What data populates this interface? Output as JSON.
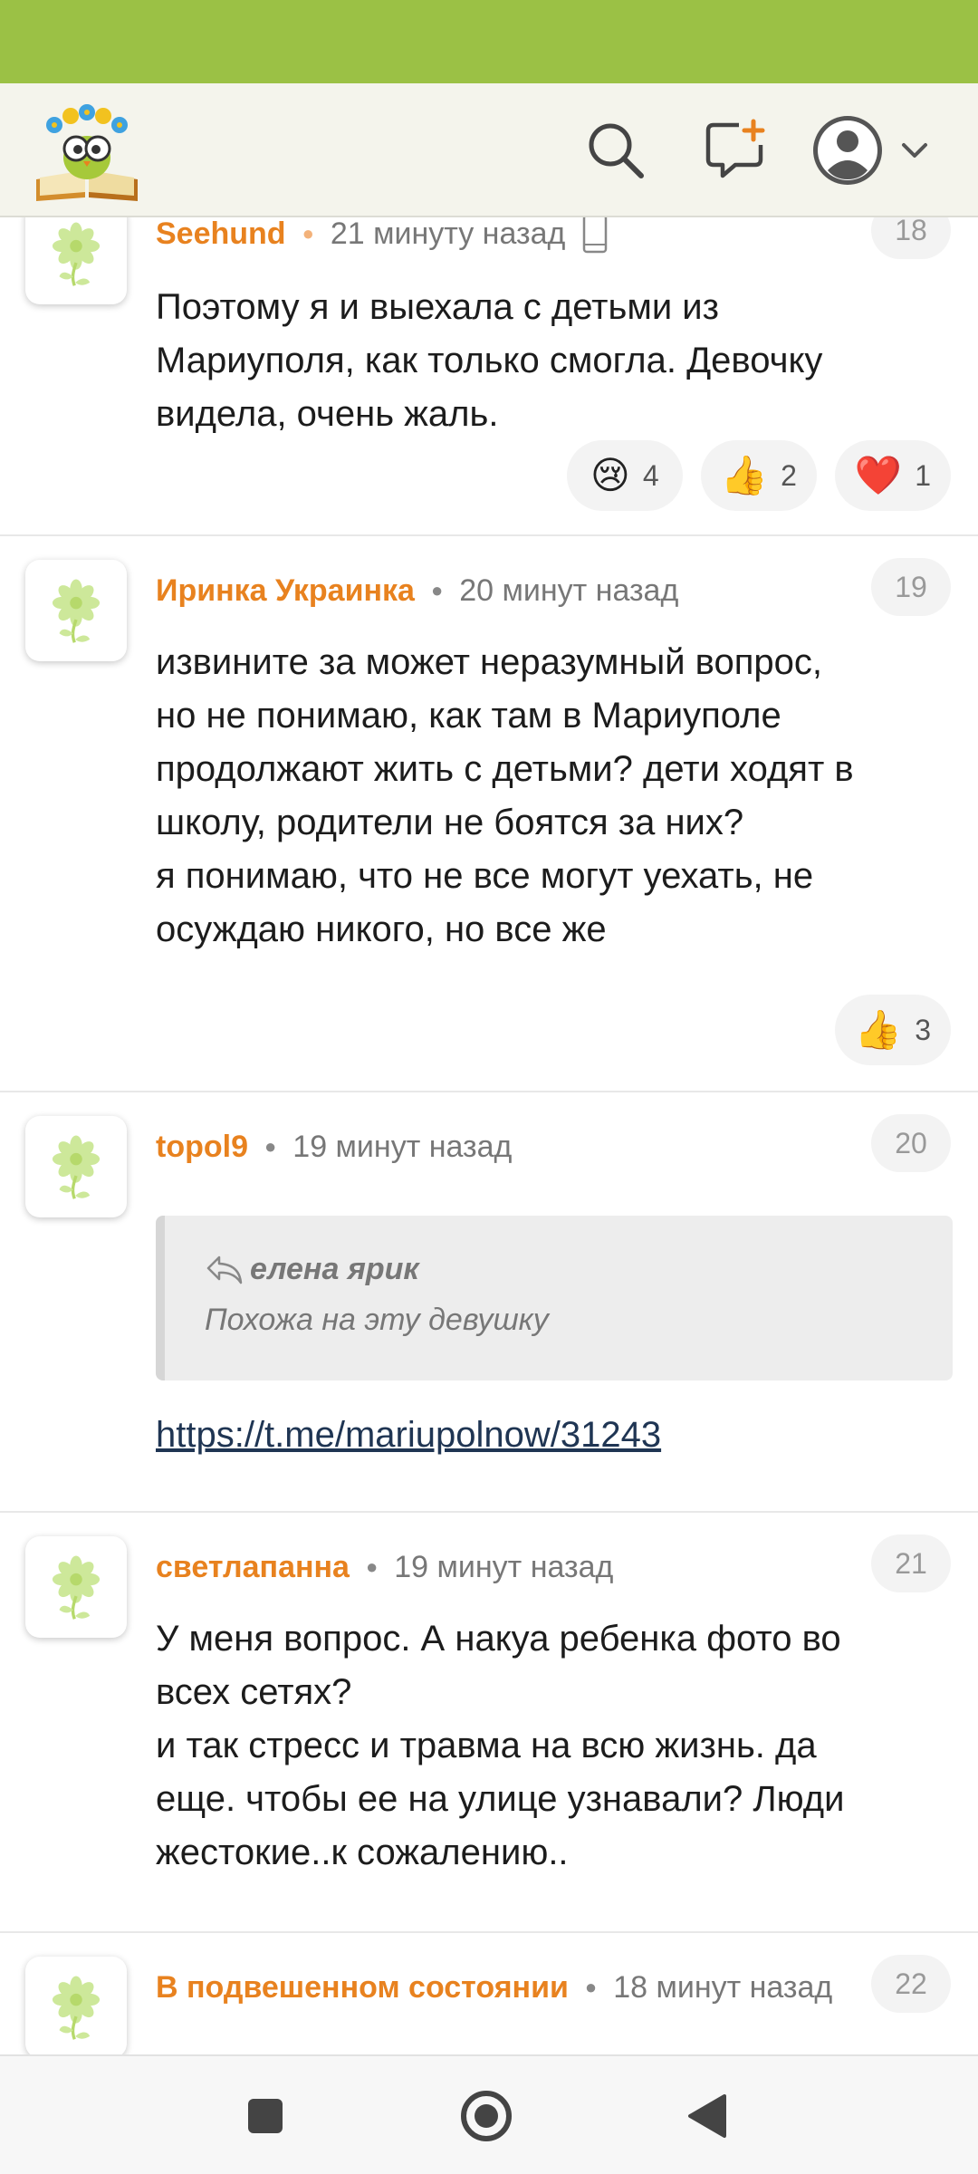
{
  "colors": {
    "status_bar": "#9bc145",
    "author": "#e8821f",
    "header": "#f4f4ec"
  },
  "header": {
    "logo": "reading-owl-logo",
    "icons": [
      "search-icon",
      "new-post-icon",
      "user-avatar-icon",
      "chevron-down-icon"
    ]
  },
  "comments": [
    {
      "author": "Seehund",
      "time": "21 минуту назад",
      "number": "18",
      "text": "Поэтому я и выехала с детьми из\nМариуполя, как только смогла. Девочку\nвидела, очень жаль.",
      "reactions": [
        {
          "emoji": "😢",
          "count": "4"
        },
        {
          "emoji": "👍",
          "count": "2"
        },
        {
          "emoji": "❤️",
          "count": "1"
        }
      ]
    },
    {
      "author": "Иринка Украинка",
      "time": "20 минут назад",
      "number": "19",
      "text": "извините за может неразумный вопрос,\nно не понимаю, как там в Мариуполе\nпродолжают жить с детьми? дети ходят в\nшколу, родители не боятся за них?\nя понимаю, что не все могут уехать, не\nосуждаю никого, но все же",
      "reactions": [
        {
          "emoji": "👍",
          "count": "3"
        }
      ]
    },
    {
      "author": "topol9",
      "time": "19 минут назад",
      "number": "20",
      "quote_author": "елена ярик",
      "quote_text": "Похожа на эту девушку",
      "link": "https://t.me/mariupolnow/31243"
    },
    {
      "author": "светлапанна",
      "time": "19 минут назад",
      "number": "21",
      "text": "У меня вопрос. А накуа ребенка фото во\nвсех сетях?\nи так стресс и травма на всю жизнь. да\nеще. чтобы ее на улице узнавали? Люди\nжестокие..к сожалению.."
    },
    {
      "author": "В подвешенном состоянии",
      "time": "18 минут назад",
      "number": "22"
    }
  ],
  "navbar": {
    "icons": [
      "recents-square-icon",
      "home-circle-icon",
      "back-triangle-icon"
    ]
  }
}
